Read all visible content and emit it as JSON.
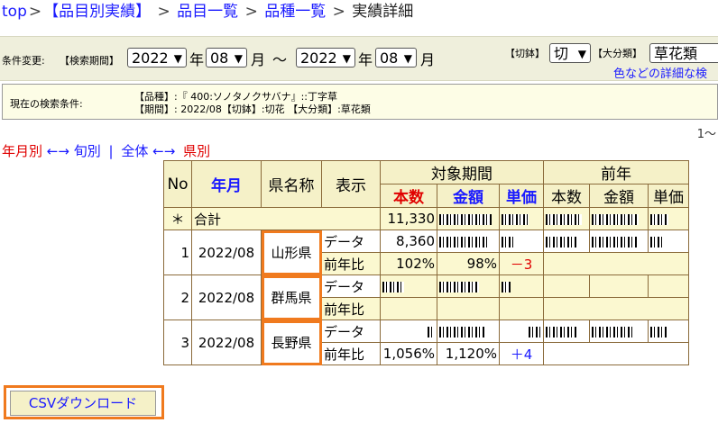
{
  "breadcrumb": {
    "top": "top",
    "current_summary": "【品目別実績】",
    "item_list": "品目一覧",
    "variety_list": "品種一覧",
    "detail": "実績詳細",
    "sep": ">"
  },
  "filter": {
    "change_label": "条件変更:",
    "period_label": "【検索期間】",
    "from_year": "2022",
    "from_month": "08",
    "to_year": "2022",
    "to_month": "08",
    "year_unit": "年",
    "month_unit": "月",
    "tilde": "〜",
    "cut_label": "【切鉢】",
    "cut_value": "切",
    "category_label": "【大分類】",
    "category_value": "草花類",
    "detail_link": "色などの詳細な検"
  },
  "condition": {
    "label": "現在の検索条件:",
    "line1": "【品種】:『 400:ソノタノクサバナ』::丁字草",
    "line2": "【期間】: 2022/08【切鉢】:切花 【大分類】:草花類"
  },
  "pager": "1〜",
  "view_switch": {
    "by_month": "年月別",
    "arrow1": "←→",
    "by_period": "旬別",
    "divider": "|",
    "all": "全体",
    "arrow2": "←→",
    "by_pref": "県別"
  },
  "table": {
    "headers": {
      "no": "No",
      "month": "年月",
      "pref": "県名称",
      "display": "表示",
      "target": "対象期間",
      "prev": "前年",
      "qty": "本数",
      "amount": "金額",
      "unit": "単価"
    },
    "total": {
      "mark": "＊",
      "label": "合計",
      "qty": "11,330"
    },
    "rows": [
      {
        "no": "1",
        "month": "2022/08",
        "pref": "山形県",
        "data_label": "データ",
        "ratio_label": "前年比",
        "qty": "8,360",
        "ratio_qty": "102%",
        "ratio_amount": "98%",
        "ratio_unit": "－3"
      },
      {
        "no": "2",
        "month": "2022/08",
        "pref": "群馬県",
        "data_label": "データ",
        "ratio_label": "前年比"
      },
      {
        "no": "3",
        "month": "2022/08",
        "pref": "長野県",
        "data_label": "データ",
        "ratio_label": "前年比",
        "ratio_qty": "1,056%",
        "ratio_amount": "1,120%",
        "ratio_unit": "＋4"
      }
    ]
  },
  "csv_button": "CSVダウンロード",
  "colors": {
    "highlight": "#f07a1e",
    "link": "#1a1aff",
    "negative": "#e00000",
    "header_bg": "#f5f1c8"
  }
}
